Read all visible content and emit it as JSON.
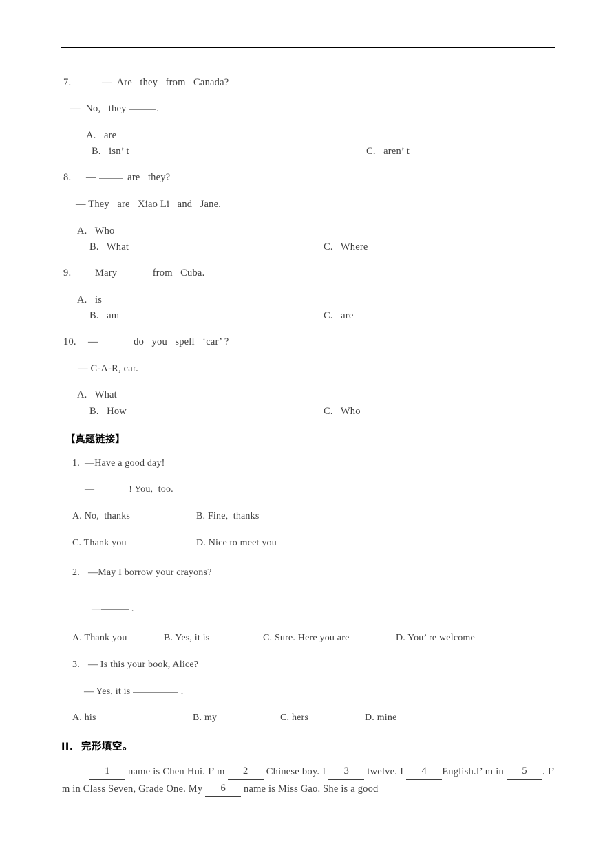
{
  "document": {
    "type": "english-exam-worksheet-page",
    "background": "#ffffff",
    "text_color": "#3f3f3f",
    "rule_color": "#000000"
  },
  "questions": [
    {
      "number": "7.",
      "stem": "—  Are   they   from   Canada?",
      "answer_line": "—  No,   they ",
      "answer_tail": ".",
      "options": {
        "a": "A.   are",
        "b": "B.   isn’ t",
        "c": "C.   aren’ t"
      }
    },
    {
      "number": "8.",
      "stem_pre": "— ",
      "stem_post": "  are   they?",
      "answer_line": "— They   are   Xiao Li   and   Jane.",
      "options": {
        "a": "A.   Who",
        "b": "B.   What",
        "c": "C.   Where"
      }
    },
    {
      "number": "9.",
      "stem_pre": "Mary ",
      "stem_post": "  from   Cuba.",
      "options": {
        "a": "A.   is",
        "b": "B.   am",
        "c": "C.   are"
      }
    },
    {
      "number": "10.",
      "stem_pre": "— ",
      "stem_post": "  do   you   spell   ‘car’ ?",
      "answer_line": "— C-A-R, car.",
      "options": {
        "a": "A.   What",
        "b": "B.   How",
        "c": "C.   Who"
      }
    }
  ],
  "real_exam_section": {
    "heading": "【真题链接】",
    "items": [
      {
        "number": "1.",
        "stem": "—Have a good day!",
        "answer_pre": "—",
        "answer_post": "! You,  too.",
        "options_row1": {
          "a": "A. No,  thanks",
          "b": "B. Fine,  thanks"
        },
        "options_row2": {
          "c": "C. Thank you",
          "d": "D. Nice to meet you"
        }
      },
      {
        "number": "2.",
        "stem": "—May I borrow your crayons?",
        "answer_pre": "—",
        "answer_post": " .",
        "options": {
          "a": "A. Thank you",
          "b": "B. Yes, it is",
          "c": "C. Sure. Here you are",
          "d": "D. You’ re welcome"
        }
      },
      {
        "number": "3.",
        "stem": "— Is this your book, Alice?",
        "answer_pre": "— Yes, it is ",
        "answer_post": " .",
        "options": {
          "a": "A. his",
          "b": "B. my",
          "c": "C. hers",
          "d": "D. mine"
        }
      }
    ]
  },
  "cloze_section": {
    "heading": "II.  完形填空。",
    "passage": {
      "seg1": " name is Chen Hui. I’ m ",
      "seg2": " Chinese boy. I ",
      "seg3": " twelve. I ",
      "seg4": "English.",
      "seg5": "I’ m in ",
      "seg6": ". I’ m in Class Seven, Grade One. My ",
      "seg7": " name is Miss Gao. She is  a good",
      "blanks": [
        "1",
        "2",
        "3",
        "4",
        "5",
        "6"
      ]
    }
  }
}
